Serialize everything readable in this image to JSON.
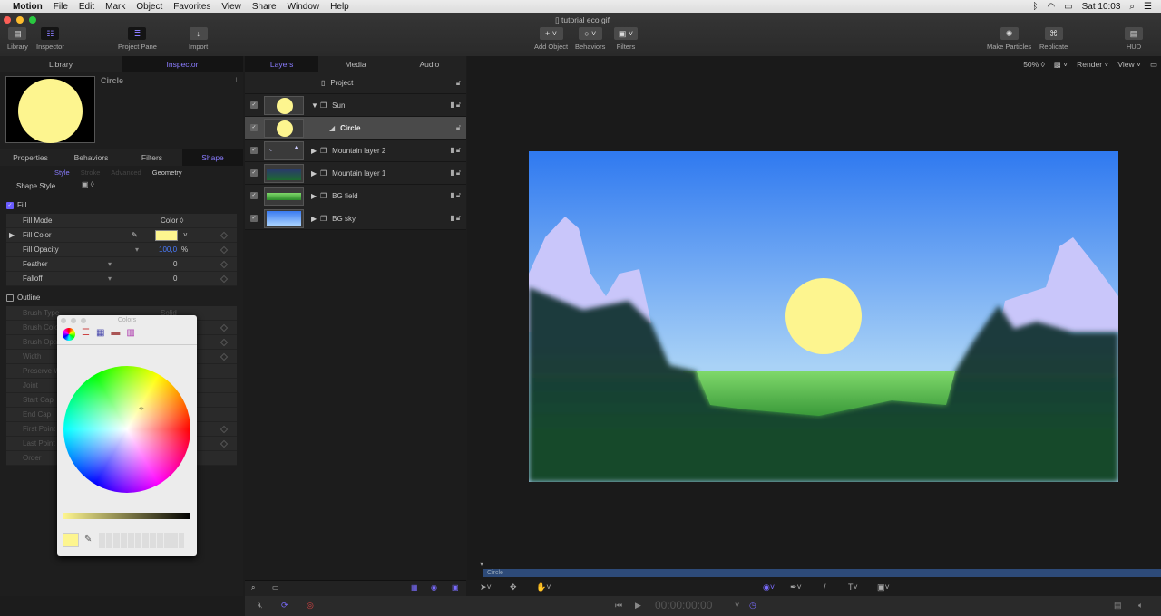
{
  "menubar": {
    "app": "Motion",
    "items": [
      "File",
      "Edit",
      "Mark",
      "Object",
      "Favorites",
      "View",
      "Share",
      "Window",
      "Help"
    ],
    "clock": "Sat 10:03"
  },
  "window": {
    "title": "tutorial eco gif"
  },
  "toolbar": {
    "library": "Library",
    "inspector": "Inspector",
    "project_pane": "Project Pane",
    "import": "Import",
    "add_object": "Add Object",
    "behaviors": "Behaviors",
    "filters": "Filters",
    "make_particles": "Make Particles",
    "replicate": "Replicate",
    "hud": "HUD"
  },
  "left_tabs": [
    "Library",
    "Inspector"
  ],
  "inspector": {
    "object_name": "Circle",
    "tabs": [
      "Properties",
      "Behaviors",
      "Filters",
      "Shape"
    ],
    "subtabs": [
      "Style",
      "Stroke",
      "Advanced",
      "Geometry"
    ],
    "shape_style": "Shape Style",
    "fill": "Fill",
    "fill_mode_label": "Fill Mode",
    "fill_mode": "Color ◊",
    "fill_color_label": "Fill Color",
    "fill_color": "#fdf58f",
    "fill_opacity_label": "Fill Opacity",
    "fill_opacity": "100,0",
    "pct": "%",
    "feather_label": "Feather",
    "feather": "0",
    "falloff_label": "Falloff",
    "falloff": "0",
    "outline": "Outline",
    "outline_rows": [
      "Brush Type",
      "Brush Color",
      "Brush Opacity",
      "Width",
      "Preserve Width",
      "Joint",
      "Start Cap",
      "End Cap",
      "First Point Offset",
      "Last Point Offset",
      "Order"
    ],
    "brush_type": "Solid"
  },
  "colors_panel": {
    "title": "Colors"
  },
  "project_tabs": [
    "Layers",
    "Media",
    "Audio"
  ],
  "layers": [
    {
      "name": "Project",
      "kind": "project"
    },
    {
      "name": "Sun",
      "kind": "group"
    },
    {
      "name": "Circle",
      "kind": "shape",
      "selected": true
    },
    {
      "name": "Mountain layer 2",
      "kind": "group"
    },
    {
      "name": "Mountain layer 1",
      "kind": "group"
    },
    {
      "name": "BG field",
      "kind": "group"
    },
    {
      "name": "BG sky",
      "kind": "group"
    }
  ],
  "canvas": {
    "zoom": "50%",
    "render": "Render",
    "view": "View"
  },
  "timeline": {
    "track_label": "Circle",
    "timecode": "00:00:00:00"
  }
}
